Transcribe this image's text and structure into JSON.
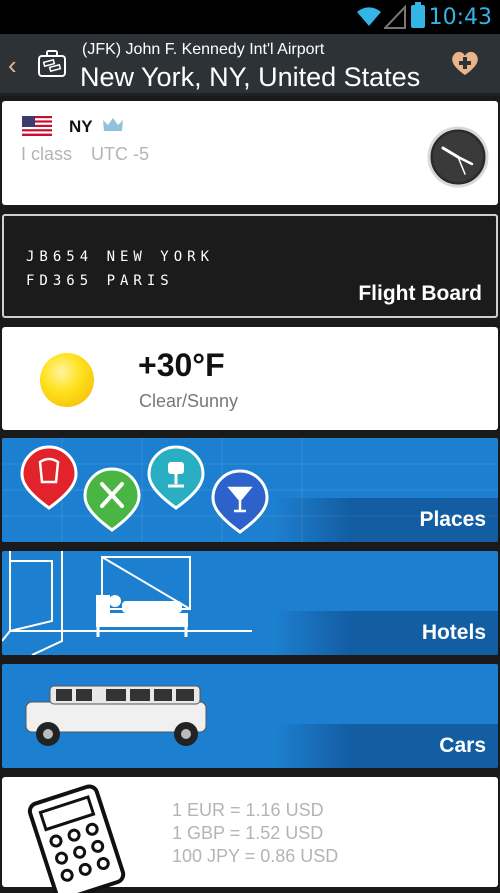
{
  "statusbar": {
    "time": "10:43"
  },
  "actionbar": {
    "subtitle": "(JFK) John F. Kennedy Int'l Airport",
    "title": "New York, NY, United States"
  },
  "city": {
    "code": "NY",
    "class": "I class",
    "utc": "UTC -5"
  },
  "flightboard": {
    "rows": [
      "JB654 NEW YORK",
      "FD365 PARIS"
    ],
    "label": "Flight Board"
  },
  "weather": {
    "temp": "+30°F",
    "condition": "Clear/Sunny"
  },
  "tiles": {
    "places": "Places",
    "hotels": "Hotels",
    "cars": "Cars"
  },
  "currency": {
    "rates": [
      "1 EUR = 1.16 USD",
      "1 GBP = 1.52 USD",
      "100 JPY = 0.86 USD"
    ]
  },
  "colors": {
    "accent": "#33b5e5",
    "tile": "#1d7fcf",
    "actionbar": "#2d3237",
    "favorite": "#e9b48a"
  }
}
